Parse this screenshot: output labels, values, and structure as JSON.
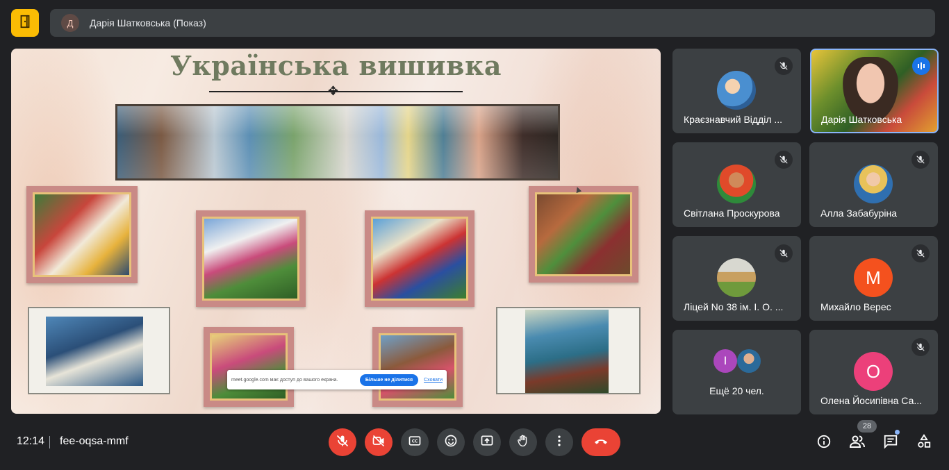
{
  "header": {
    "presenter_initial": "Д",
    "presenter_label": "Дарія Шатковська (Показ)"
  },
  "presentation": {
    "slide_title": "Українська вишивка",
    "share_toast": {
      "text": "meet.google.com має доступ до вашого екрана.",
      "stop_label": "Більше не ділитися",
      "hide_label": "Сховати"
    }
  },
  "participants": [
    {
      "name": "Краєзнавчий Відділ ...",
      "muted": true,
      "avatar": "photo"
    },
    {
      "name": "Дарія Шатковська",
      "muted": false,
      "speaking": true,
      "avatar": "video"
    },
    {
      "name": "Світлана Проскурова",
      "muted": true,
      "avatar": "photo"
    },
    {
      "name": "Алла Забабуріна",
      "muted": true,
      "avatar": "photo"
    },
    {
      "name": "Ліцей No 38 ім. І. О. ...",
      "muted": true,
      "avatar": "photo"
    },
    {
      "name": "Михайло Верес",
      "muted": true,
      "initial": "M",
      "color": "#f4511e"
    },
    {
      "name": "Ещё 20 чел.",
      "initial": "I",
      "color": "#ab47bc"
    },
    {
      "name": "Олена Йосипівна Са...",
      "muted": true,
      "initial": "O",
      "color": "#ec407a"
    }
  ],
  "footer": {
    "time": "12:14",
    "meeting_code": "fee-oqsa-mmf",
    "participant_count": "28"
  },
  "colors": {
    "background": "#202124",
    "tile": "#3c4043",
    "danger": "#ea4335",
    "accent": "#8ab4f8",
    "logo": "#fbbc04"
  },
  "icons": [
    "door-exit-icon",
    "mic-off-icon",
    "camera-off-icon",
    "captions-icon",
    "emoji-icon",
    "present-icon",
    "raise-hand-icon",
    "more-icon",
    "end-call-icon",
    "info-icon",
    "people-icon",
    "chat-icon",
    "activities-icon",
    "audio-level-icon"
  ]
}
